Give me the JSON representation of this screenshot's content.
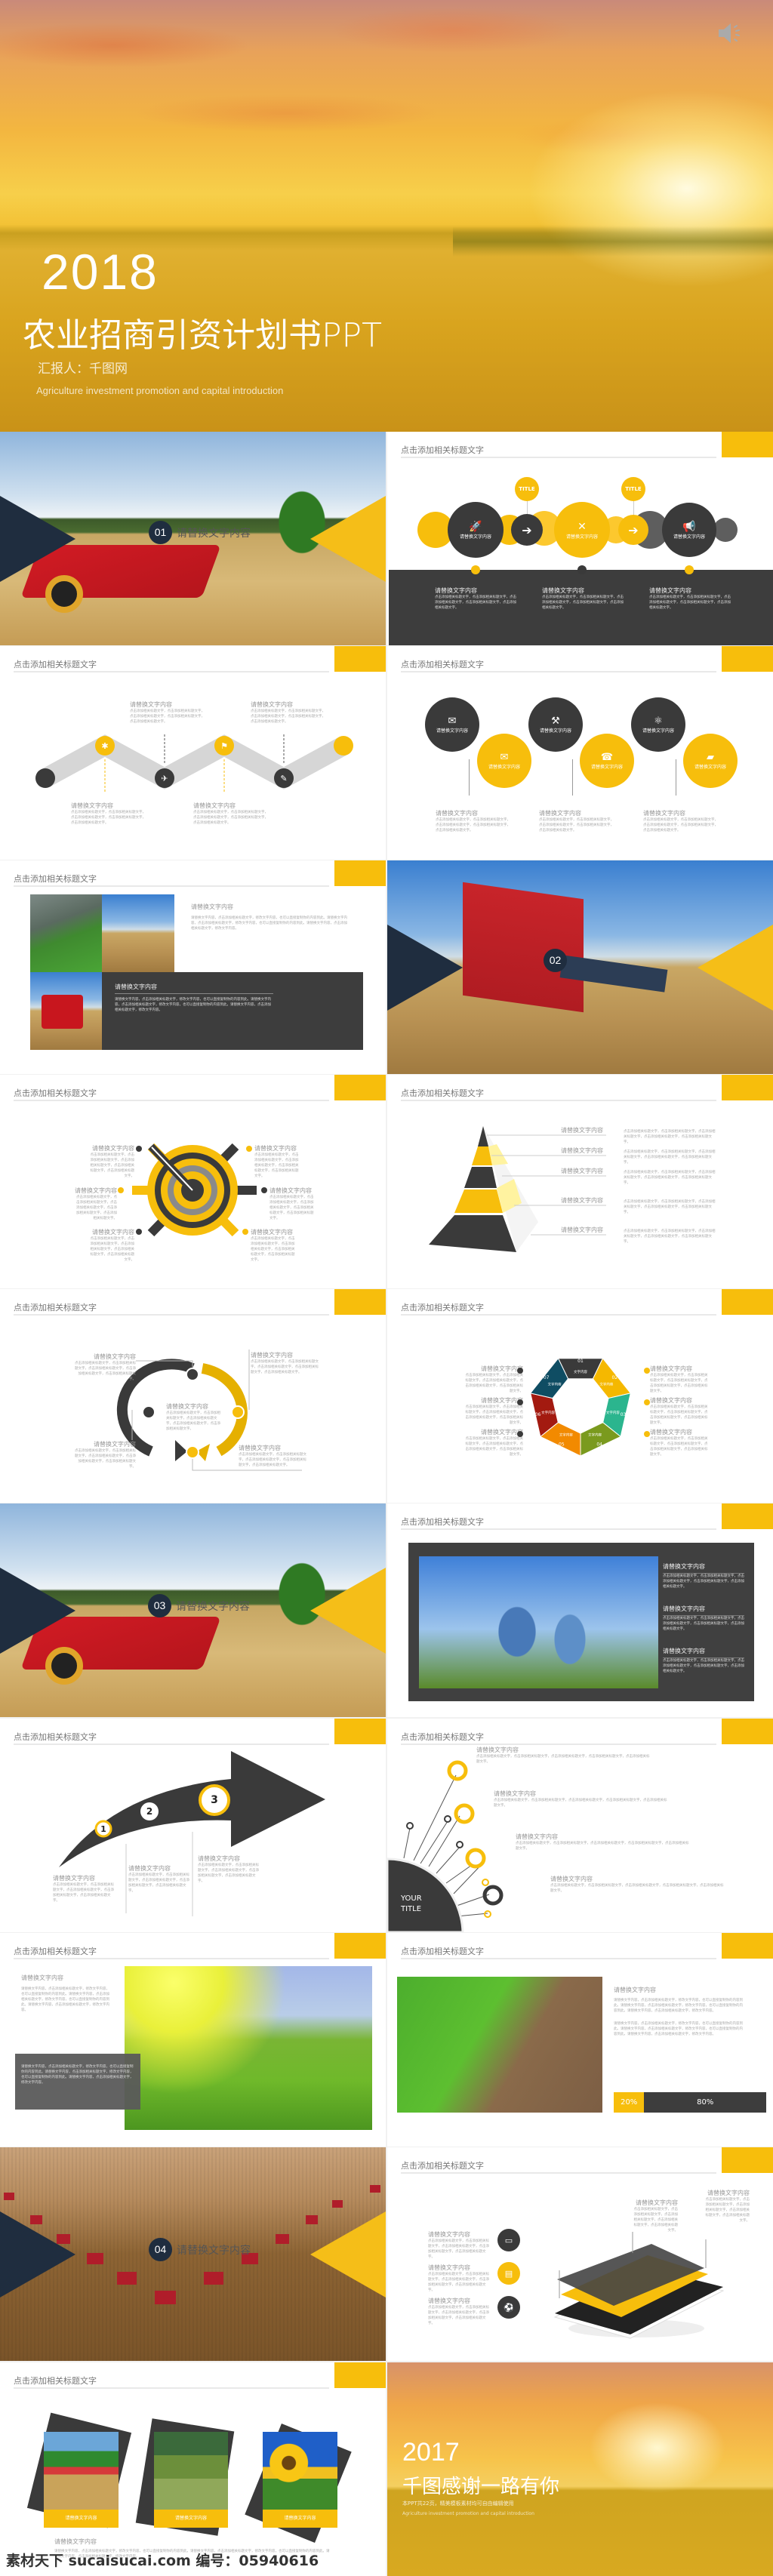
{
  "hero": {
    "year": "2018",
    "title": "农业招商引资计划书PPT",
    "reporter": "汇报人：千图网",
    "subtitle_en": "Agriculture investment promotion and capital introduction",
    "speaker_icon": "speaker-icon"
  },
  "common": {
    "slide_title": "点击添加相关标题文字",
    "item_title": "请替换文字内容",
    "body": "点击添加相关标题文字，点击添加相关标题文字，点击添加相关标题文字，点击添加相关标题文字，点击添加相关标题文字。",
    "body_long": "请替换文字内容，点击添加相关标题文字，修改文字内容，也可以直接复制你的内容到此。请替换文字内容，点击添加相关标题文字，修改文字内容，也可以直接复制你的内容到此。请替换文字内容，点击添加相关标题文字，修改文字内容。"
  },
  "sections": [
    {
      "number": "01",
      "label": "请替换文字内容"
    },
    {
      "number": "02",
      "label": ""
    },
    {
      "number": "03",
      "label": "请替换文字内容"
    },
    {
      "number": "04",
      "label": "请替换文字内容"
    }
  ],
  "circle_slide": {
    "tag_1": "TITLE",
    "tag_2": "TITLE"
  },
  "heptagon": {
    "numbers": [
      "01",
      "02",
      "03",
      "04",
      "05",
      "06",
      "07"
    ],
    "inner_label": "文字内容",
    "colors": [
      "#3a3a3a",
      "#f5b800",
      "#2bb58e",
      "#7a9a1e",
      "#f28a00",
      "#a31a10",
      "#0f4d63"
    ]
  },
  "arrow_slide": {
    "steps": [
      "1",
      "2",
      "3"
    ]
  },
  "radial_slide": {
    "center_label_1": "YOUR",
    "center_label_2": "TITLE"
  },
  "progress": {
    "left_label": "20%",
    "right_label": "80%",
    "left_value": 20,
    "right_value": 80
  },
  "ending": {
    "year": "2017",
    "title": "千图感谢一路有你",
    "note": "本PPT共22页，精美模板素材均可自由编辑使用",
    "subtitle_en": "Agriculture investment promotion and capital introduction"
  },
  "watermark": "素材天下 sucaisucai.com  编号：05940616",
  "colors": {
    "accent": "#f7be0c",
    "dark": "#3a3a3a",
    "navy": "#1f2d3f"
  }
}
